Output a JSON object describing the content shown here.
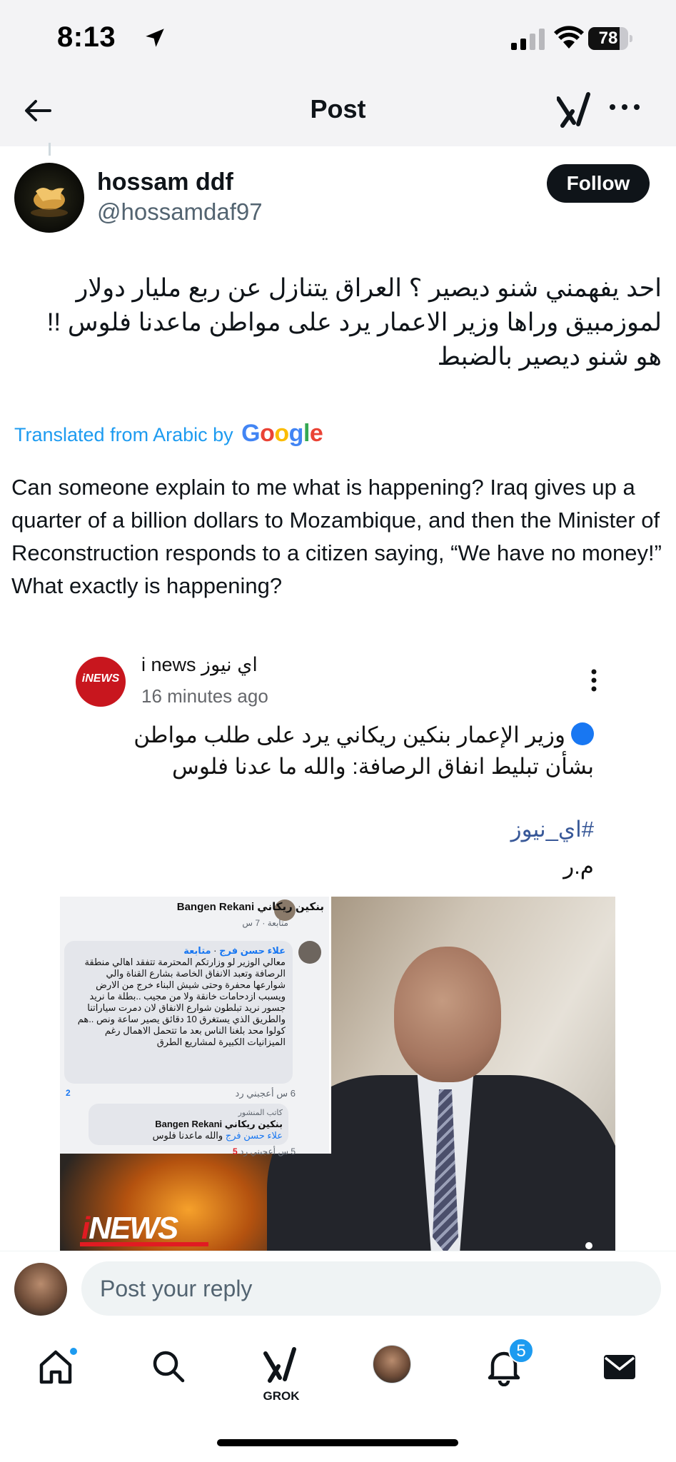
{
  "status_bar": {
    "time": "8:13",
    "battery": "78",
    "battery_level": 0.78
  },
  "header": {
    "title": "Post"
  },
  "post": {
    "author_name": "hossam ddf",
    "author_handle": "@hossamdaf97",
    "follow_label": "Follow",
    "text_original": "احد يفهمني شنو ديصير ؟ العراق يتنازل عن ربع مليار دولار لموزمبيق وراها وزير الاعمار يرد على مواطن ماعدنا فلوس !! هو شنو ديصير بالضبط",
    "translated_label": "Translated from Arabic by",
    "translated_brand": "Google",
    "text_translated": "Can someone explain to me what is happening? Iraq gives up a quarter of a billion dollars to Mozambique, and then the Minister of Reconstruction responds to a citizen saying, “We have no money!” What exactly is happening?"
  },
  "quoted": {
    "avatar_text": "iNEWS",
    "name": "i news اي نيوز",
    "time": "16 minutes ago",
    "body": "وزير الإعمار بنكين ريكاني يرد على طلب مواطن بشأن تبليط انفاق الرصافة: والله ما عدنا فلوس",
    "hashtag": "#اي_نيوز",
    "signature": "م.ر"
  },
  "media": {
    "screenshot_title": "بنكين ريكاني Bangen Rekani",
    "screenshot_follow": "متابعة",
    "screenshot_time": "7 س",
    "comment_author": "علاء حسن فرج",
    "comment_follow": "متابعة",
    "comment_text": "معالي الوزير لو وزارتكم المحترمة تتفقد اهالي منطقة الرصافة وتعبد الانفاق الخاصة بشارع القناة والي شوارعها محفرة وحتى شيش البناء خرج من الارض ويسبب ازدحامات خانقة ولا من مجيب ..بطلة ما نريد جسور نريد تبلطون شوارع الانفاق لان دمرت سياراتنا والطريق الذي يستغرق 10 دقائق يصير ساعة ونص ..هم كولوا محد بلغنا الناس بعد ما تتحمل الاهمال رغم الميزانيات الكبيرة لمشاريع الطرق",
    "comment_meta": "6 س أعجبني رد",
    "comment_count": "2",
    "reply_label": "كاتب المنشور",
    "reply_author": "بنكين ريكاني Bangen Rekani",
    "reply_tag": "علاء حسن فرج",
    "reply_text": "والله ماعدنا فلوس",
    "reply_meta": "5 س أعجبني رد",
    "reply_count": "5",
    "logo_text": "iNEWS"
  },
  "reply_bar": {
    "placeholder": "Post your reply"
  },
  "tab_bar": {
    "grok_label": "GROK",
    "notifications_count": "5"
  },
  "colors": {
    "accent": "#1d9bf0",
    "text_primary": "#0f1419",
    "text_secondary": "#536471",
    "follow_bg": "#0f1419"
  }
}
